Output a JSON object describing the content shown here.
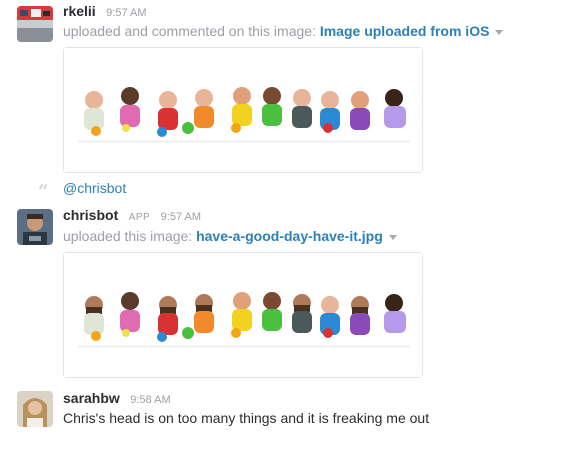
{
  "messages": [
    {
      "user": "rkelii",
      "time": "9:57 AM",
      "action": "uploaded and commented on this image:",
      "file": "Image uploaded from iOS",
      "comment_mention": "@chrisbot"
    },
    {
      "user": "chrisbot",
      "badge": "APP",
      "time": "9:57 AM",
      "action": "uploaded this image:",
      "file": "have-a-good-day-have-it.jpg"
    },
    {
      "user": "sarahbw",
      "time": "9:58 AM",
      "text": "Chris's head is on too many things and it is freaking me out"
    }
  ],
  "colors": {
    "link": "#2a80b9",
    "muted": "#9e9ea6",
    "text": "#2c2d30"
  },
  "icons": [
    "quote-icon",
    "dropdown-caret-icon"
  ]
}
